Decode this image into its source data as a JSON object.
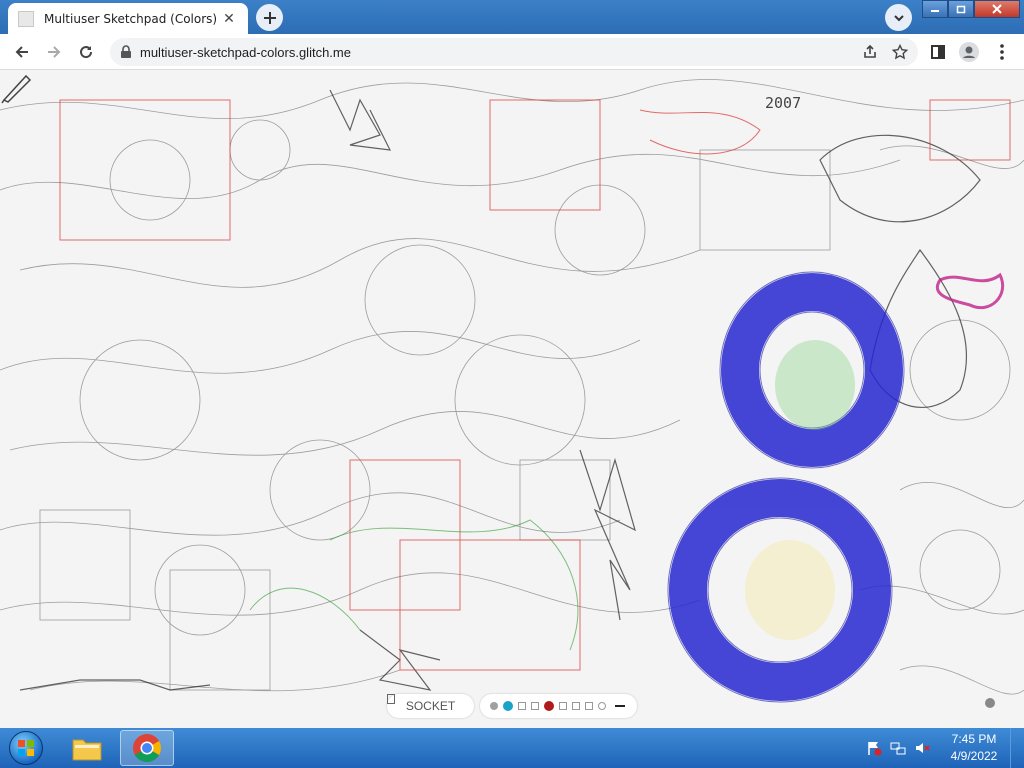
{
  "browser": {
    "tab_title": "Multiuser Sketchpad (Colors)",
    "url": "multiuser-sketchpad-colors.glitch.me"
  },
  "canvas": {
    "sketch_texts": [
      "2007"
    ],
    "socket_label": "SOCKET",
    "palette": [
      "#a0a0a0",
      "#1aa3c8",
      "#ffffff",
      "#ffffff",
      "#b01a1a",
      "#ffffff",
      "#ffffff",
      "#ffffff",
      "#ffffff"
    ],
    "accent_blue": "#2626d0"
  },
  "taskbar": {
    "time": "7:45 PM",
    "date": "4/9/2022"
  }
}
